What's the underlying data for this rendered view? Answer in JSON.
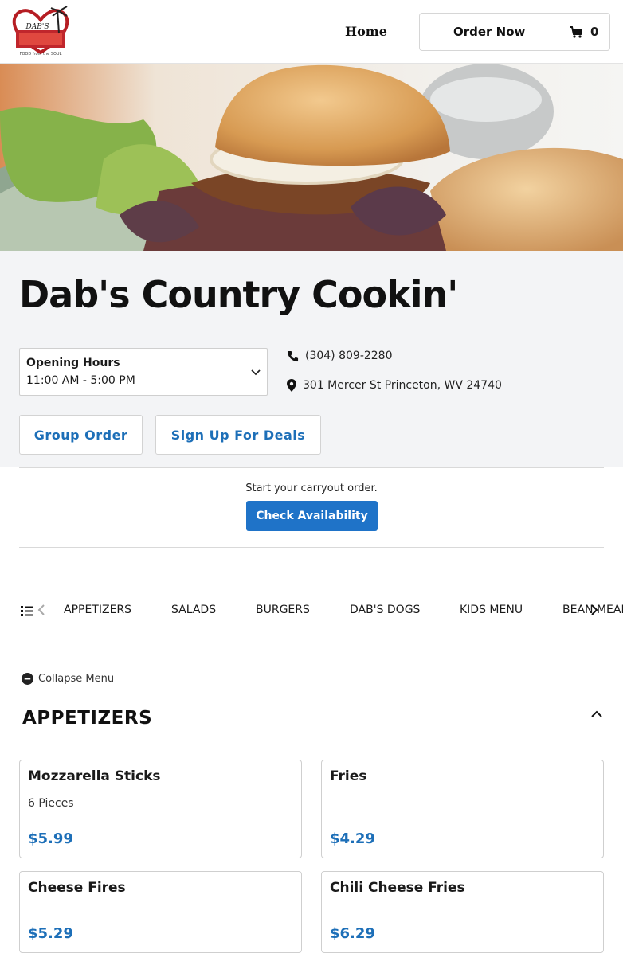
{
  "header": {
    "logo_text": "DAB'S",
    "logo_tagline": "FOOD from the SOUL",
    "nav_home": "Home",
    "order_label": "Order Now",
    "cart_count": "0"
  },
  "restaurant": {
    "name": "Dab's Country Cookin'",
    "hours_label": "Opening Hours",
    "hours_value": "11:00 AM - 5:00 PM",
    "phone": "(304) 809-2280",
    "address": "301 Mercer St Princeton, WV 24740"
  },
  "actions": {
    "group_order": "Group Order",
    "deals": "Sign Up For Deals"
  },
  "carryout": {
    "text": "Start your carryout order.",
    "button": "Check Availability"
  },
  "categories": [
    "APPETIZERS",
    "SALADS",
    "BURGERS",
    "DAB'S DOGS",
    "KIDS MENU",
    "BEAN MEAL"
  ],
  "menu": {
    "collapse_label": "Collapse Menu",
    "section_title": "APPETIZERS",
    "items": [
      {
        "name": "Mozzarella Sticks",
        "desc": "6 Pieces",
        "price": "$5.99"
      },
      {
        "name": "Fries",
        "desc": "",
        "price": "$4.29"
      },
      {
        "name": "Cheese Fires",
        "desc": "",
        "price": "$5.29"
      },
      {
        "name": "Chili Cheese Fries",
        "desc": "",
        "price": "$6.29"
      }
    ]
  },
  "colors": {
    "accent": "#1f73c8",
    "price": "#1d6fb8",
    "info_bg": "#f3f4f6"
  }
}
